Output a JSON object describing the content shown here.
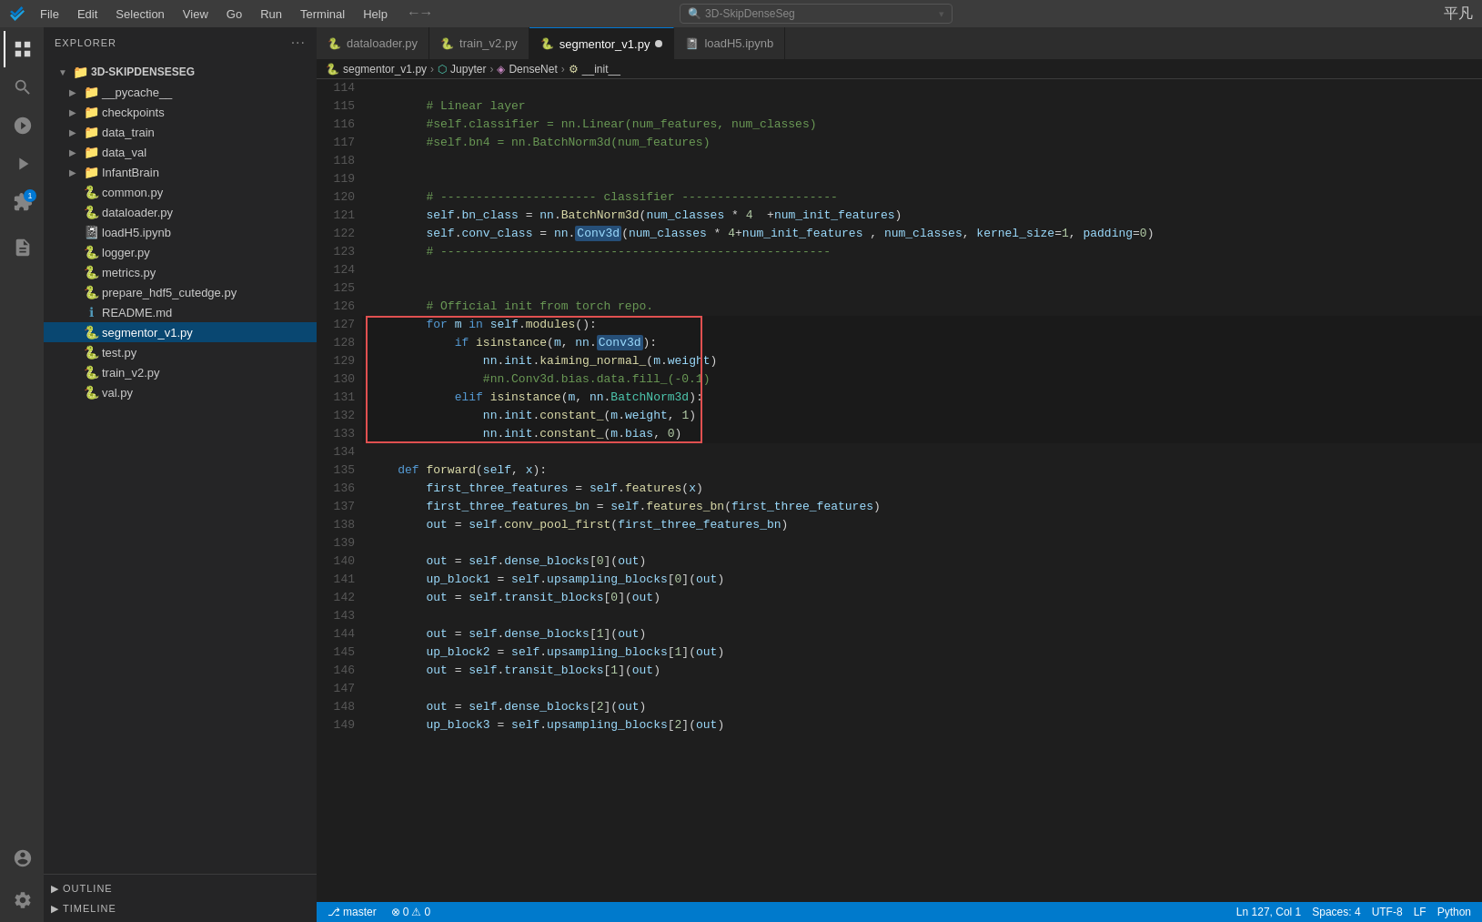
{
  "titlebar": {
    "menus": [
      "File",
      "Edit",
      "Selection",
      "View",
      "Go",
      "Run",
      "Terminal",
      "Help"
    ],
    "search_placeholder": "3D-SkipDenseSeg",
    "watermark": "平凡"
  },
  "sidebar": {
    "title": "EXPLORER",
    "root_folder": "3D-SKIPDENSESEG",
    "items": [
      {
        "id": "pycache",
        "label": "__pycache__",
        "type": "folder",
        "indent": 1
      },
      {
        "id": "checkpoints",
        "label": "checkpoints",
        "type": "folder",
        "indent": 1
      },
      {
        "id": "data_train",
        "label": "data_train",
        "type": "folder",
        "indent": 1
      },
      {
        "id": "data_val",
        "label": "data_val",
        "type": "folder",
        "indent": 1
      },
      {
        "id": "infantbrain",
        "label": "InfantBrain",
        "type": "folder",
        "indent": 1
      },
      {
        "id": "common_py",
        "label": "common.py",
        "type": "py",
        "indent": 1
      },
      {
        "id": "dataloader_py",
        "label": "dataloader.py",
        "type": "py",
        "indent": 1
      },
      {
        "id": "loadh5_ipynb",
        "label": "loadH5.ipynb",
        "type": "ipynb",
        "indent": 1
      },
      {
        "id": "logger_py",
        "label": "logger.py",
        "type": "py",
        "indent": 1
      },
      {
        "id": "metrics_py",
        "label": "metrics.py",
        "type": "py",
        "indent": 1
      },
      {
        "id": "prepare_hdf5_py",
        "label": "prepare_hdf5_cutedge.py",
        "type": "py",
        "indent": 1
      },
      {
        "id": "readme_md",
        "label": "README.md",
        "type": "md",
        "indent": 1
      },
      {
        "id": "segmentor_v1_py",
        "label": "segmentor_v1.py",
        "type": "py",
        "indent": 1,
        "active": true
      },
      {
        "id": "test_py",
        "label": "test.py",
        "type": "py",
        "indent": 1
      },
      {
        "id": "train_v2_py",
        "label": "train_v2.py",
        "type": "py",
        "indent": 1
      },
      {
        "id": "val_py",
        "label": "val.py",
        "type": "py",
        "indent": 1
      }
    ],
    "outline_label": "OUTLINE",
    "timeline_label": "TIMELINE"
  },
  "tabs": [
    {
      "label": "dataloader.py",
      "type": "py",
      "active": false
    },
    {
      "label": "train_v2.py",
      "type": "py",
      "active": false
    },
    {
      "label": "segmentor_v1.py",
      "type": "py",
      "active": true,
      "modified": true
    },
    {
      "label": "loadH5.ipynb",
      "type": "ipynb",
      "active": false
    }
  ],
  "breadcrumb": {
    "file": "segmentor_v1.py",
    "jupyter": "Jupyter",
    "densenet": "DenseNet",
    "init": "__init__"
  },
  "code": {
    "lines": [
      {
        "num": 114,
        "text": ""
      },
      {
        "num": 115,
        "text": "        # Linear layer"
      },
      {
        "num": 116,
        "text": "        #self.classifier = nn.Linear(num_features, num_classes)"
      },
      {
        "num": 117,
        "text": "        #self.bn4 = nn.BatchNorm3d(num_features)"
      },
      {
        "num": 118,
        "text": ""
      },
      {
        "num": 119,
        "text": ""
      },
      {
        "num": 120,
        "text": "        # ---------------------- classifier ----------------------"
      },
      {
        "num": 121,
        "text": "        self.bn_class = nn.BatchNorm3d(num_classes * 4  +num_init_features)"
      },
      {
        "num": 122,
        "text": "        self.conv_class = nn.Conv3d(num_classes * 4+num_init_features , num_classes, kernel_size=1, padding=0)"
      },
      {
        "num": 123,
        "text": "        # -------------------------------------------------------"
      },
      {
        "num": 124,
        "text": ""
      },
      {
        "num": 125,
        "text": ""
      },
      {
        "num": 126,
        "text": "        # Official init from torch repo."
      },
      {
        "num": 127,
        "text": "        for m in self.modules():"
      },
      {
        "num": 128,
        "text": "            if isinstance(m, nn.Conv3d):"
      },
      {
        "num": 129,
        "text": "                nn.init.kaiming_normal_(m.weight)"
      },
      {
        "num": 130,
        "text": "                #nn.Conv3d.bias.data.fill_(-0.1)"
      },
      {
        "num": 131,
        "text": "            elif isinstance(m, nn.BatchNorm3d):"
      },
      {
        "num": 132,
        "text": "                nn.init.constant_(m.weight, 1)"
      },
      {
        "num": 133,
        "text": "                nn.init.constant_(m.bias, 0)"
      },
      {
        "num": 134,
        "text": ""
      },
      {
        "num": 135,
        "text": "    def forward(self, x):"
      },
      {
        "num": 136,
        "text": "        first_three_features = self.features(x)"
      },
      {
        "num": 137,
        "text": "        first_three_features_bn = self.features_bn(first_three_features)"
      },
      {
        "num": 138,
        "text": "        out = self.conv_pool_first(first_three_features_bn)"
      },
      {
        "num": 139,
        "text": ""
      },
      {
        "num": 140,
        "text": "        out = self.dense_blocks[0](out)"
      },
      {
        "num": 141,
        "text": "        up_block1 = self.upsampling_blocks[0](out)"
      },
      {
        "num": 142,
        "text": "        out = self.transit_blocks[0](out)"
      },
      {
        "num": 143,
        "text": ""
      },
      {
        "num": 144,
        "text": "        out = self.dense_blocks[1](out)"
      },
      {
        "num": 145,
        "text": "        up_block2 = self.upsampling_blocks[1](out)"
      },
      {
        "num": 146,
        "text": "        out = self.transit_blocks[1](out)"
      },
      {
        "num": 147,
        "text": ""
      },
      {
        "num": 148,
        "text": "        out = self.dense_blocks[2](out)"
      },
      {
        "num": 149,
        "text": "        up_block3 = self.upsampling_blocks[2](out)"
      }
    ]
  },
  "status": {
    "git_branch": "master",
    "errors": "0",
    "warnings": "0",
    "language": "Python",
    "encoding": "UTF-8",
    "line_ending": "LF",
    "spaces": "Spaces: 4",
    "position": "Ln 127, Col 1"
  }
}
